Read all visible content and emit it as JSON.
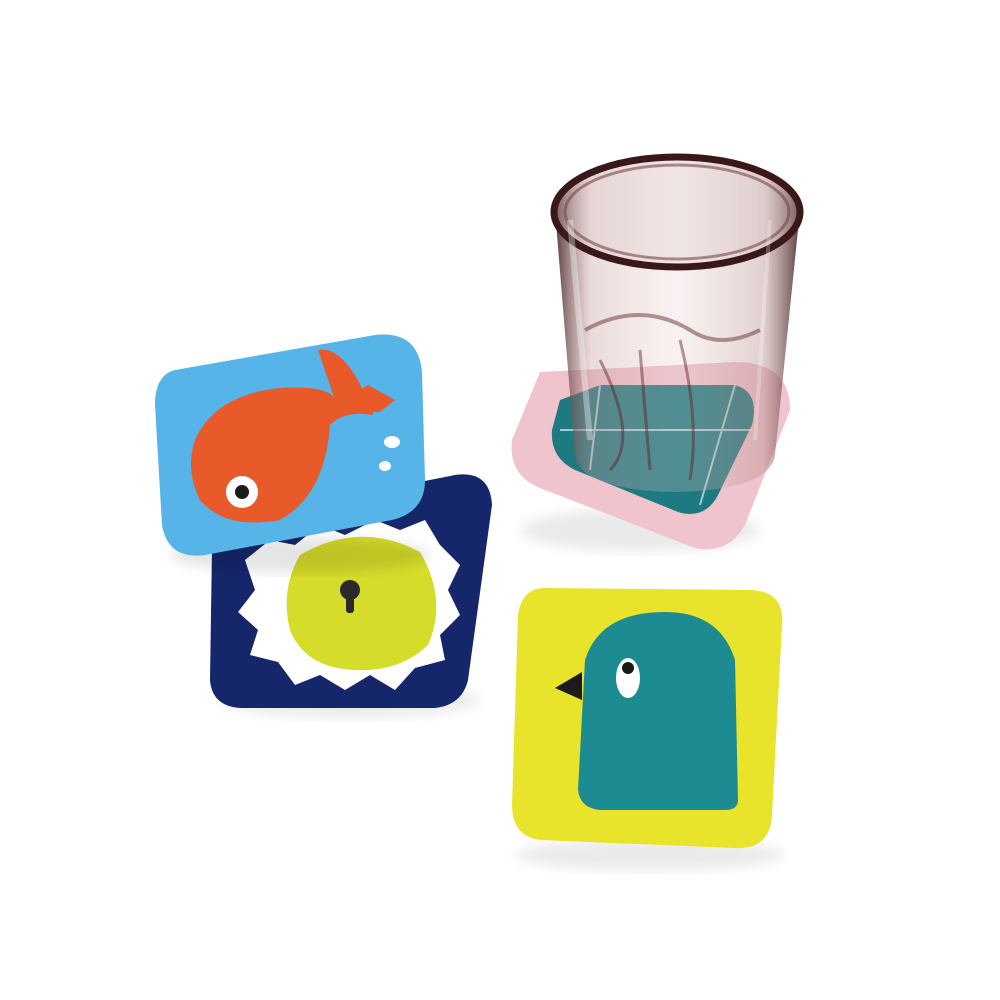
{
  "background": "#ffffff",
  "coasters": [
    {
      "name": "fish-coaster",
      "base": "#57b4e8",
      "motif": "#e85a2a",
      "eye": "#ffffff",
      "pupil": "#1b1b1b"
    },
    {
      "name": "lion-coaster",
      "base": "#16266b",
      "mane": "#ffffff",
      "face": "#d6dc2a",
      "nose": "#2a2a2a"
    },
    {
      "name": "bird-coaster",
      "base": "#e8e42c",
      "body": "#1d8c92",
      "beak": "#1b1b1b",
      "eye": "#ffffff"
    },
    {
      "name": "pink-coaster",
      "base": "#efc4cd",
      "inner": "#1d7a80",
      "lines": "#ffffff"
    }
  ],
  "glass": {
    "tint": "#5a2a2a",
    "rim": "#3a1818"
  }
}
